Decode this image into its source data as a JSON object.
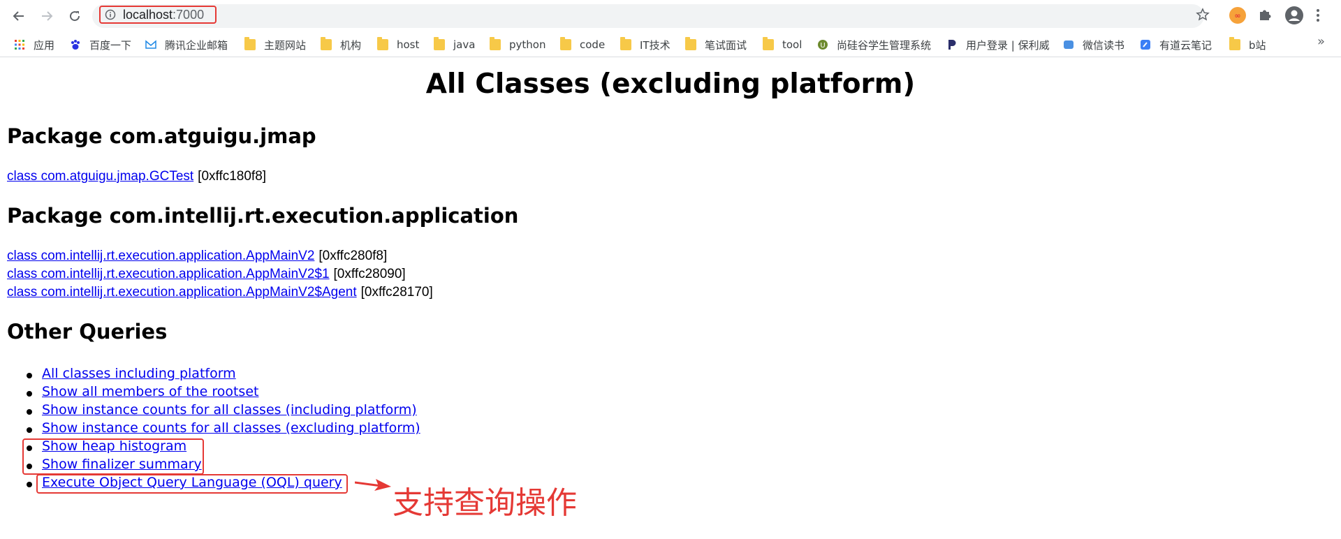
{
  "browser": {
    "url_host": "localhost",
    "url_port": ":7000",
    "bookmarks": [
      {
        "label": "应用",
        "icon": "apps-grid-icon"
      },
      {
        "label": "百度一下",
        "icon": "baidu-paw-icon"
      },
      {
        "label": "腾讯企业邮箱",
        "icon": "tencent-mail-icon"
      },
      {
        "label": "主题网站",
        "icon": "folder-icon"
      },
      {
        "label": "机构",
        "icon": "folder-icon"
      },
      {
        "label": "host",
        "icon": "folder-icon"
      },
      {
        "label": "java",
        "icon": "folder-icon"
      },
      {
        "label": "python",
        "icon": "folder-icon"
      },
      {
        "label": "code",
        "icon": "folder-icon"
      },
      {
        "label": "IT技术",
        "icon": "folder-icon"
      },
      {
        "label": "笔试面试",
        "icon": "folder-icon"
      },
      {
        "label": "tool",
        "icon": "folder-icon"
      },
      {
        "label": "尚硅谷学生管理系统",
        "icon": "atguigu-logo-icon"
      },
      {
        "label": "用户登录 | 保利威",
        "icon": "polyv-logo-icon"
      },
      {
        "label": "微信读书",
        "icon": "weread-icon"
      },
      {
        "label": "有道云笔记",
        "icon": "youdao-note-icon"
      },
      {
        "label": "b站",
        "icon": "folder-icon"
      }
    ],
    "more_label": "»"
  },
  "page": {
    "title": "All Classes (excluding platform)",
    "packages": [
      {
        "heading": "Package com.atguigu.jmap",
        "classes": [
          {
            "name": "class com.atguigu.jmap.GCTest",
            "addr": "[0xffc180f8]"
          }
        ]
      },
      {
        "heading": "Package com.intellij.rt.execution.application",
        "classes": [
          {
            "name": "class com.intellij.rt.execution.application.AppMainV2",
            "addr": "[0xffc280f8]"
          },
          {
            "name": "class com.intellij.rt.execution.application.AppMainV2$1",
            "addr": "[0xffc28090]"
          },
          {
            "name": "class com.intellij.rt.execution.application.AppMainV2$Agent",
            "addr": "[0xffc28170]"
          }
        ]
      }
    ],
    "other_heading": "Other Queries",
    "queries": [
      "All classes including platform",
      "Show all members of the rootset",
      "Show instance counts for all classes (including platform)",
      "Show instance counts for all classes (excluding platform)",
      "Show heap histogram",
      "Show finalizer summary",
      "Execute Object Query Language (OQL) query"
    ]
  },
  "annotation": {
    "text": "支持查询操作",
    "color": "#e53935"
  },
  "colors": {
    "link": "#0000ee",
    "highlight": "#e53935",
    "folder": "#f7c948"
  }
}
